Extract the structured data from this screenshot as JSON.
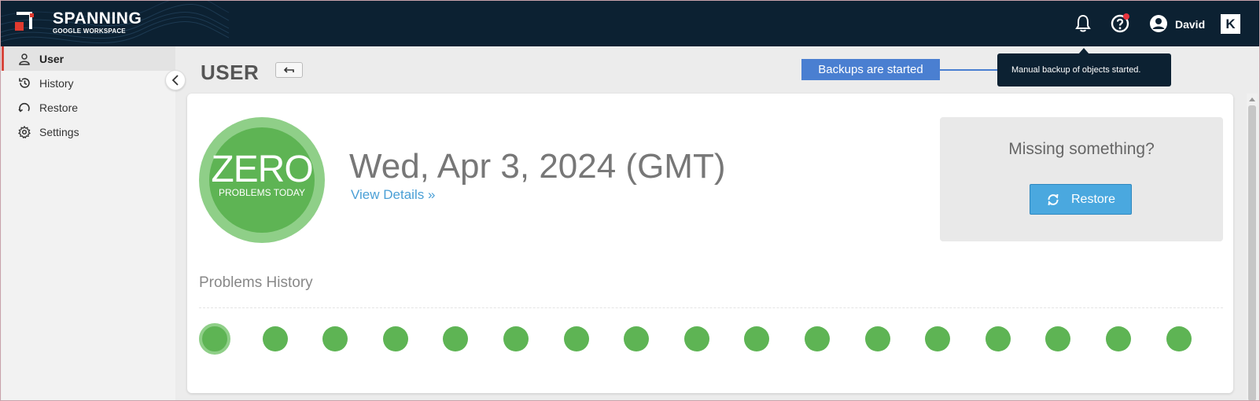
{
  "brand": {
    "name": "SPANNING",
    "sub": "GOOGLE WORKSPACE"
  },
  "topbar": {
    "user_name": "David",
    "badge_letter": "K"
  },
  "sidebar": {
    "items": [
      {
        "label": "User",
        "icon": "user-icon",
        "active": true
      },
      {
        "label": "History",
        "icon": "history-icon",
        "active": false
      },
      {
        "label": "Restore",
        "icon": "restore-icon",
        "active": false
      },
      {
        "label": "Settings",
        "icon": "settings-icon",
        "active": false
      }
    ]
  },
  "header": {
    "title": "USER"
  },
  "hint": {
    "text": "Backups are started"
  },
  "toast": {
    "text": "Manual backup of objects started."
  },
  "summary": {
    "zero_big": "ZERO",
    "zero_small": "PROBLEMS TODAY",
    "date": "Wed, Apr 3, 2024 (GMT)",
    "view_details": "View Details »"
  },
  "missing": {
    "title": "Missing something?",
    "button_label": "Restore"
  },
  "problems_history": {
    "title": "Problems History",
    "days": 17
  },
  "colors": {
    "topbar": "#0c2132",
    "status_green": "#5eb454",
    "accent_blue": "#4aa8df",
    "active_red": "#d7473d"
  }
}
